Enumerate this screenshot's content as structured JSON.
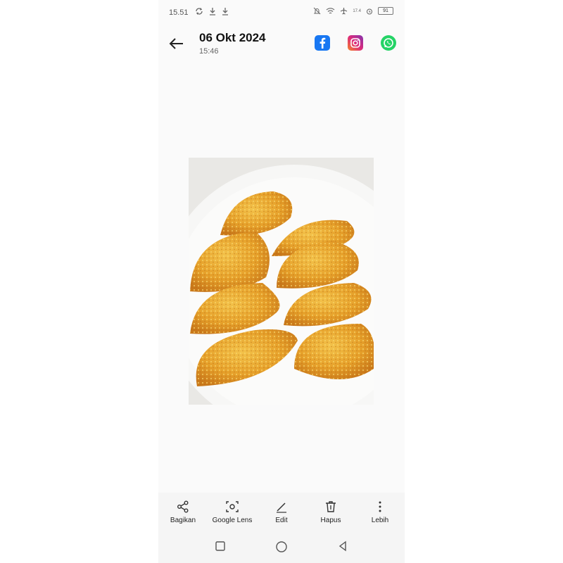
{
  "status_bar": {
    "time": "15.51",
    "network_speed": "17.4",
    "battery": "91"
  },
  "header": {
    "date": "06 Okt 2024",
    "time": "15:46"
  },
  "share_apps": [
    {
      "icon": "facebook-icon",
      "color": "#1877f2"
    },
    {
      "icon": "instagram-icon",
      "color": "#dd2a7b"
    },
    {
      "icon": "whatsapp-icon",
      "color": "#25d366"
    }
  ],
  "actions": [
    {
      "label": "Bagikan",
      "icon": "share-icon"
    },
    {
      "label": "Google Lens",
      "icon": "lens-icon"
    },
    {
      "label": "Edit",
      "icon": "edit-icon"
    },
    {
      "label": "Hapus",
      "icon": "trash-icon"
    },
    {
      "label": "Lebih",
      "icon": "more-icon"
    }
  ],
  "navigation": [
    "recents-icon",
    "home-icon",
    "back-icon"
  ]
}
